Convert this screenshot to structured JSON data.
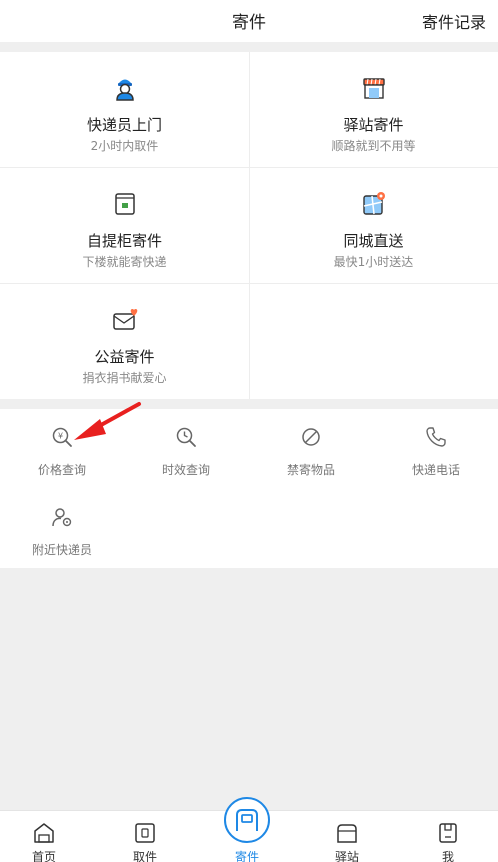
{
  "header": {
    "title": "寄件",
    "record_link": "寄件记录"
  },
  "services": [
    {
      "name": "快递员上门",
      "desc": "2小时内取件",
      "icon": "courier-icon"
    },
    {
      "name": "驿站寄件",
      "desc": "顺路就到不用等",
      "icon": "station-store-icon"
    },
    {
      "name": "自提柜寄件",
      "desc": "下楼就能寄快递",
      "icon": "locker-icon"
    },
    {
      "name": "同城直送",
      "desc": "最快1小时送达",
      "icon": "city-map-icon"
    },
    {
      "name": "公益寄件",
      "desc": "捐衣捐书献爱心",
      "icon": "charity-mail-icon"
    }
  ],
  "tools": [
    {
      "label": "价格查询",
      "icon": "price-search-icon"
    },
    {
      "label": "时效查询",
      "icon": "time-search-icon"
    },
    {
      "label": "禁寄物品",
      "icon": "prohibited-icon"
    },
    {
      "label": "快递电话",
      "icon": "phone-icon"
    },
    {
      "label": "附近快递员",
      "icon": "nearby-courier-icon"
    }
  ],
  "tabbar": [
    {
      "label": "首页",
      "icon": "home-icon"
    },
    {
      "label": "取件",
      "icon": "pickup-icon"
    },
    {
      "label": "寄件",
      "icon": "send-icon",
      "active": true
    },
    {
      "label": "驿站",
      "icon": "station-icon"
    },
    {
      "label": "我",
      "icon": "profile-icon"
    }
  ],
  "colors": {
    "accent": "#1e88e5",
    "arrow": "#e8201f",
    "heart": "#ff7043"
  }
}
